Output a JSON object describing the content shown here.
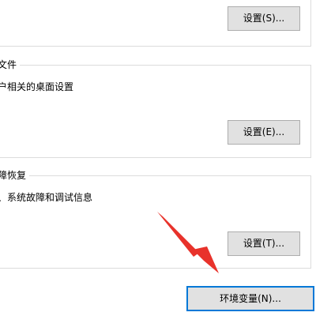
{
  "performance_group": {
    "settings_button": "设置(S)..."
  },
  "profile_group": {
    "title": "文件",
    "description": "户相关的桌面设置",
    "settings_button": "设置(E)..."
  },
  "startup_group": {
    "title": "障恢复",
    "description": "、系统故障和调试信息",
    "settings_button": "设置(T)..."
  },
  "env_button": "环境变量(N)...",
  "colors": {
    "button_face": "#e1e1e1",
    "button_border": "#adadad",
    "focus_border": "#0078d7",
    "arrow": "#e8322b"
  },
  "annotation": {
    "icon": "red-arrow-icon"
  }
}
